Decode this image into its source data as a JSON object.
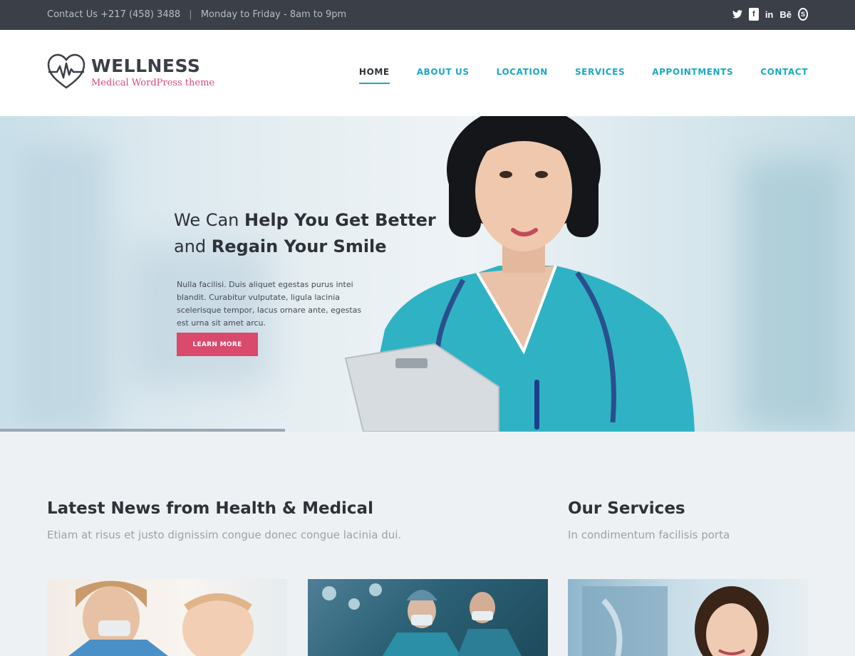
{
  "topbar": {
    "contact": "Contact Us +217 (458) 3488",
    "separator": "|",
    "hours": "Monday to Friday - 8am to 9pm",
    "social": [
      {
        "name": "twitter-icon",
        "glyph": "🐦"
      },
      {
        "name": "facebook-icon",
        "glyph": "f"
      },
      {
        "name": "linkedin-icon",
        "glyph": "in"
      },
      {
        "name": "behance-icon",
        "glyph": "Bē"
      },
      {
        "name": "skype-icon",
        "glyph": "S"
      }
    ]
  },
  "logo": {
    "title": "WELLNESS",
    "subtitle": "Medical WordPress theme"
  },
  "nav": {
    "items": [
      "HOME",
      "ABOUT US",
      "LOCATION",
      "SERVICES",
      "APPOINTMENTS",
      "CONTACT"
    ],
    "active": "HOME"
  },
  "hero": {
    "line1_light": "We Can",
    "line1_bold": "Help You Get Better",
    "line2_light": "and",
    "line2_bold": "Regain Your Smile",
    "body": "Nulla facilisi. Duis aliquet egestas purus intei blandit. Curabitur vulputate, ligula lacinia scelerisque tempor, lacus ornare ante, egestas est urna sit amet arcu.",
    "button": "LEARN MORE"
  },
  "news": {
    "title_light": "Latest News from",
    "title_bold": "Health & Medical",
    "subtitle": "Etiam at risus et justo dignissim congue donec congue lacinia dui."
  },
  "services": {
    "title_light": "Our",
    "title_bold": "Services",
    "subtitle": "In condimentum facilisis porta"
  },
  "colors": {
    "accent": "#1ba8c2",
    "brand_pink": "#d94a6d",
    "topbar": "#3a3f48"
  }
}
